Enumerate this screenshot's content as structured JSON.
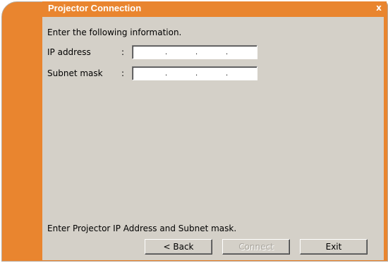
{
  "window": {
    "title": "Projector Connection",
    "close_label": "x",
    "accent_color": "#e9852f",
    "panel_color": "#d4d0c8"
  },
  "form": {
    "instruction": "Enter the following information.",
    "ip_label": "IP address",
    "ip_colon": ":",
    "ip_value": "",
    "subnet_label": "Subnet mask",
    "subnet_colon": ":",
    "subnet_value": "",
    "separator": "."
  },
  "status": {
    "message": "Enter Projector IP Address and Subnet mask."
  },
  "buttons": {
    "back_label": "< Back",
    "connect_label": "Connect",
    "exit_label": "Exit"
  }
}
